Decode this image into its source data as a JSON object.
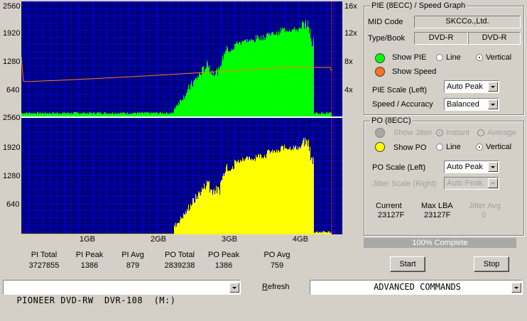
{
  "graph": {
    "y_ticks": [
      "2560",
      "1920",
      "1280",
      "640"
    ],
    "speed_ticks": [
      "16x",
      "12x",
      "8x",
      "4x"
    ],
    "x_ticks": [
      "1GB",
      "2GB",
      "3GB",
      "4GB"
    ]
  },
  "stats": [
    {
      "label": "PI Total",
      "value": "3727855"
    },
    {
      "label": "PI Peak",
      "value": "1386"
    },
    {
      "label": "PI Avg",
      "value": "879"
    },
    {
      "label": "PO Total",
      "value": "2839238"
    },
    {
      "label": "PO Peak",
      "value": "1386"
    },
    {
      "label": "PO Avg",
      "value": "759"
    }
  ],
  "pie_panel": {
    "title": "PIE (8ECC) / Speed Graph",
    "mid_label": "MID Code",
    "mid_value": "SKCCo.,Ltd.",
    "type_label": "Type/Book",
    "type_value": "DVD-R",
    "book_value": "DVD-R",
    "show_pie": "Show PIE",
    "show_speed": "Show Speed",
    "line": "Line",
    "vertical": "Vertical",
    "scale_label": "PIE Scale (Left)",
    "scale_value": "Auto Peak",
    "speed_label": "Speed / Accuracy",
    "speed_value": "Balanced"
  },
  "po_panel": {
    "title": "PO (8ECC)",
    "show_jitter": "Show Jitter",
    "instant": "Instant",
    "average": "Average",
    "show_po": "Show PO",
    "line": "Line",
    "vertical": "Vertical",
    "scale_label": "PO Scale (Left)",
    "scale_value": "Auto Peak",
    "jitter_label": "Jitter Scale (Right)",
    "jitter_value": "Auto Peak",
    "current_label": "Current",
    "current_value": "23127F",
    "maxlba_label": "Max LBA",
    "maxlba_value": "23127F",
    "jitter_avg_label": "Jitter Avg",
    "jitter_avg_value": "0"
  },
  "progress": {
    "text": "100% Complete",
    "fraction": 1.0
  },
  "buttons": {
    "start": "Start",
    "stop": "Stop",
    "refresh": "Refresh"
  },
  "drive": {
    "value": "PIONEER DVD-RW  DVR-108  (M:)"
  },
  "commands": {
    "value": "ADVANCED COMMANDS"
  },
  "colors": {
    "plot_bg": "#000080",
    "grid": "#0000ff",
    "pie": "#00ff00",
    "po": "#ffff00",
    "speed": "#ff8000",
    "end_marker": "#ff0000"
  }
}
